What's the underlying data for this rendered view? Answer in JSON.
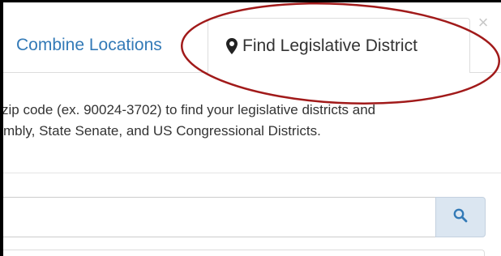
{
  "tabs": {
    "combine_label": "Combine Locations",
    "find_label": "Find Legislative District",
    "find_icon": "map-marker-icon",
    "active": "Find Legislative District"
  },
  "close_label": "×",
  "description": {
    "line1": "zip code (ex. 90024-3702) to find your legislative districts and",
    "line2": "mbly, State Senate, and US Congressional Districts."
  },
  "search": {
    "value": "",
    "placeholder": "",
    "button_icon": "search-icon"
  },
  "colors": {
    "link": "#337ab7",
    "text": "#333333",
    "search_button_bg": "#dbe6f1",
    "search_icon": "#337ab7",
    "annotation_ellipse": "#a11a1a"
  }
}
